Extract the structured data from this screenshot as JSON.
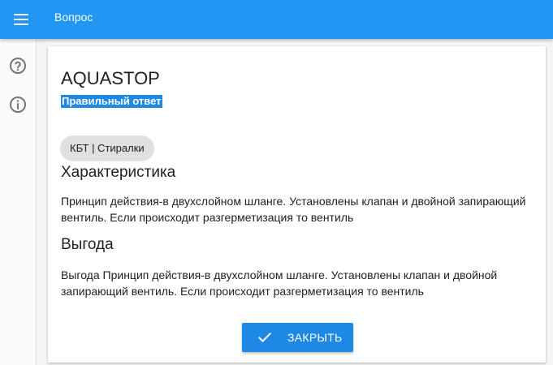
{
  "topbar": {
    "title": "Вопрос",
    "menu_icon": "menu-icon",
    "background": "#2196f3"
  },
  "sidebar": {
    "items": [
      {
        "icon": "help-circle-icon"
      },
      {
        "icon": "info-circle-icon"
      }
    ]
  },
  "card": {
    "title": "AQUASTOP",
    "answer_label": "Правильный ответ",
    "chip": "КБТ | Стиралки",
    "sections": [
      {
        "heading": "Характеристика",
        "text": "Принцип действия-в двухслойном шланге. Установлены клапан и двойной запирающий вентиль. Если происходит разгерметизация то вентиль"
      },
      {
        "heading": "Выгода",
        "text": "Выгода Принцип действия-в двухслойном шланге. Установлены клапан и двойной запирающий вентиль. Если происходит разгерметизация то вентиль"
      }
    ],
    "close_button": {
      "label": "ЗАКРЫТЬ",
      "icon": "check-icon",
      "color": "#1e88e5"
    }
  }
}
